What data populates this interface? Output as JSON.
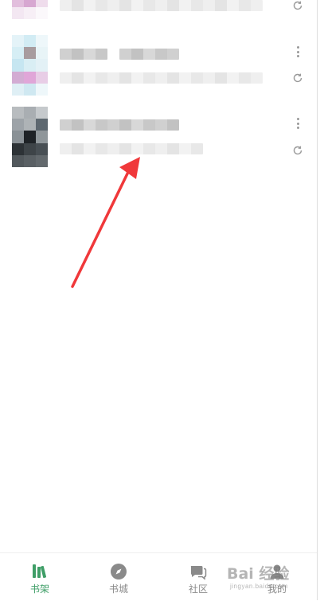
{
  "tabs": [
    {
      "label": "书架",
      "icon": "bookshelf-icon",
      "active": true
    },
    {
      "label": "书城",
      "icon": "compass-icon",
      "active": false
    },
    {
      "label": "社区",
      "icon": "chat-bubble-icon",
      "active": false
    },
    {
      "label": "我的",
      "icon": "person-icon",
      "active": false
    }
  ],
  "watermark": {
    "brand": "Bai 经验",
    "sub": "jingyan.baidu.com"
  },
  "colors": {
    "accent": "#3f9e67",
    "arrow": "#f0383a",
    "tab_inactive": "#8a8a8a"
  }
}
